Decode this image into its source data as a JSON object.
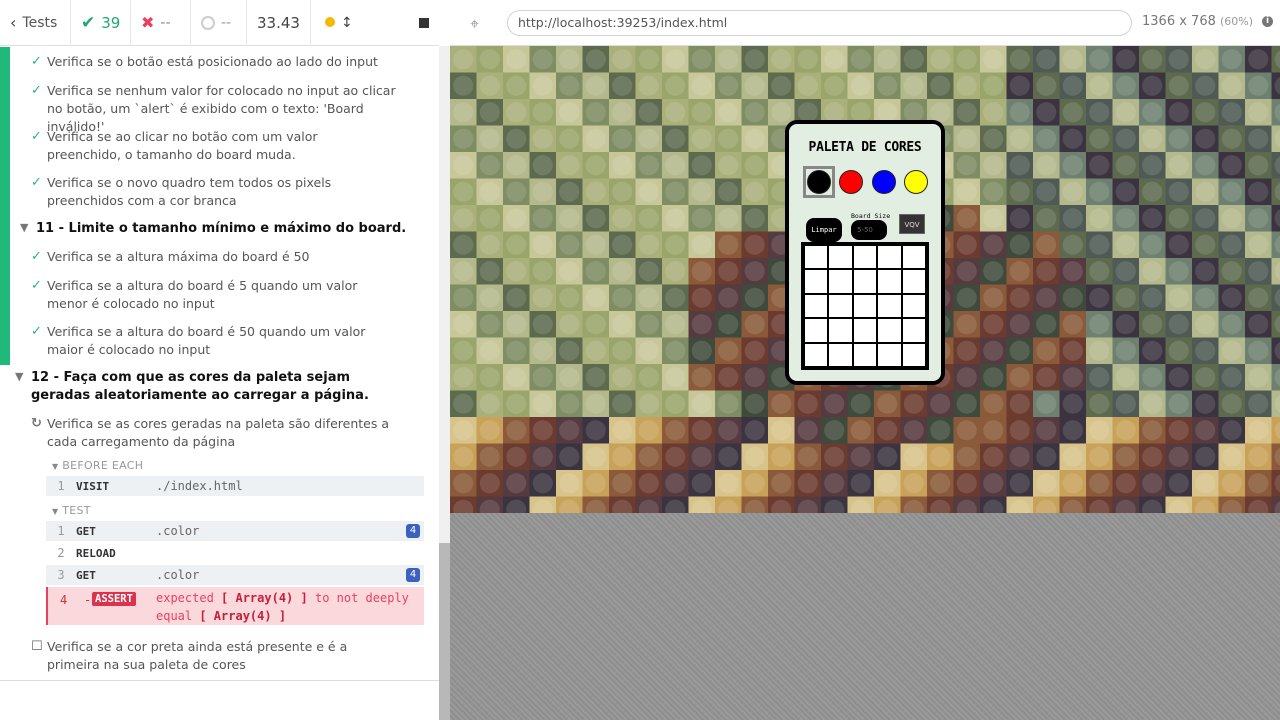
{
  "topbar": {
    "tests_label": "Tests",
    "passed": "39",
    "failed": "--",
    "pending": "--",
    "duration": "33.43"
  },
  "url": "http://localhost:39253/index.html",
  "viewport": {
    "size": "1366 x 768",
    "scale": "(60%)"
  },
  "tests": [
    {
      "text": "Verifica se o botão está posicionado ao lado do input"
    },
    {
      "text": "Verifica se nenhum valor for colocado no input ao clicar no botão, um `alert` é exibido com o texto: 'Board inválido!'"
    },
    {
      "text": "Verifica se ao clicar no botão com um valor preenchido, o tamanho do board muda."
    },
    {
      "text": "Verifica se o novo quadro tem todos os pixels preenchidos com a cor branca"
    }
  ],
  "suite11": {
    "title": "11 - Limite o tamanho mínimo e máximo do board.",
    "tests": [
      "Verifica se a altura máxima do board é 50",
      "Verifica se a altura do board é 5 quando um valor menor é colocado no input",
      "Verifica se a altura do board é 50 quando um valor maior é colocado no input"
    ]
  },
  "suite12": {
    "title": "12 - Faça com que as cores da paleta sejam geradas aleatoriamente ao carregar a página.",
    "running": "Verifica se as cores geradas na paleta são diferentes a cada carregamento da página",
    "before_each": "BEFORE EACH",
    "test_hdr": "TEST",
    "pending": "Verifica se a cor preta ainda está presente e é a primeira na sua paleta de cores"
  },
  "commands": {
    "before": [
      {
        "num": "1",
        "name": "VISIT",
        "msg": "./index.html"
      }
    ],
    "test": [
      {
        "num": "1",
        "name": "GET",
        "msg": ".color",
        "badge": "4"
      },
      {
        "num": "2",
        "name": "RELOAD",
        "msg": ""
      },
      {
        "num": "3",
        "name": "GET",
        "msg": ".color",
        "badge": "4"
      }
    ],
    "assert": {
      "num": "4",
      "dash": "-",
      "tag": "ASSERT",
      "expected": "expected",
      "arr1": "[ Array(4) ]",
      "mid": "to not deeply equal",
      "arr2": "[ Array(4) ]"
    }
  },
  "app": {
    "title": "PALETA DE CORES",
    "clear": "Limpar",
    "board_size": "Board Size",
    "placeholder": "5-50",
    "vqv": "VQV",
    "palette": [
      "#000000",
      "#ff0000",
      "#0000ff",
      "#ffff00"
    ]
  },
  "colors": {
    "pass": "#1fb97a",
    "fail": "#e9405f",
    "pending_dot": "#f5b800"
  }
}
